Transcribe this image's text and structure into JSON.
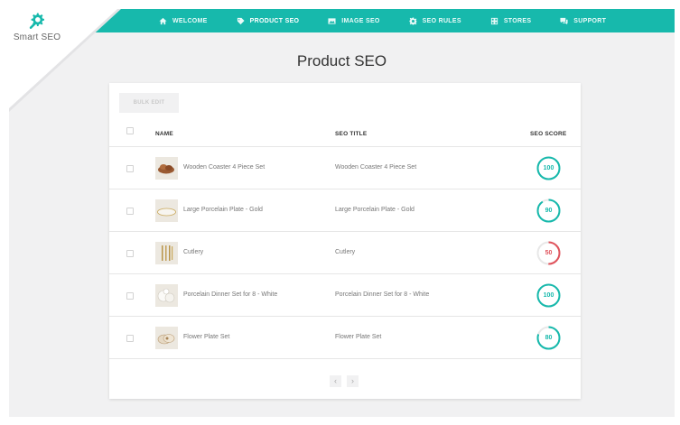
{
  "app": {
    "name": "Smart SEO"
  },
  "colors": {
    "accent": "#17b9ac",
    "score_good": "#17b9ac",
    "score_bad": "#e0535c"
  },
  "nav": [
    {
      "label": "WELCOME",
      "icon": "home-icon"
    },
    {
      "label": "PRODUCT SEO",
      "icon": "tag-icon",
      "active": true
    },
    {
      "label": "IMAGE SEO",
      "icon": "image-icon"
    },
    {
      "label": "SEO RULES",
      "icon": "gear-icon"
    },
    {
      "label": "STORES",
      "icon": "store-icon"
    },
    {
      "label": "SUPPORT",
      "icon": "chat-icon"
    }
  ],
  "page": {
    "title": "Product SEO"
  },
  "toolbar": {
    "bulk_edit": "BULK EDIT"
  },
  "table": {
    "headers": {
      "name": "NAME",
      "seo_title": "SEO TITLE",
      "seo_score": "SEO SCORE"
    },
    "rows": [
      {
        "name": "Wooden Coaster 4 Piece Set",
        "seo_title": "Wooden Coaster 4 Piece Set",
        "score": 100,
        "thumb": "coaster-image"
      },
      {
        "name": "Large Porcelain Plate - Gold",
        "seo_title": "Large Porcelain Plate - Gold",
        "score": 90,
        "thumb": "plate-image"
      },
      {
        "name": "Cutlery",
        "seo_title": "Cutlery",
        "score": 50,
        "thumb": "cutlery-image"
      },
      {
        "name": "Porcelain Dinner Set for 8 - White",
        "seo_title": "Porcelain Dinner Set for 8 - White",
        "score": 100,
        "thumb": "dinner-set-image"
      },
      {
        "name": "Flower Plate Set",
        "seo_title": "Flower Plate Set",
        "score": 80,
        "thumb": "flower-plate-image"
      }
    ]
  },
  "pager": {
    "prev": "‹",
    "next": "›"
  }
}
